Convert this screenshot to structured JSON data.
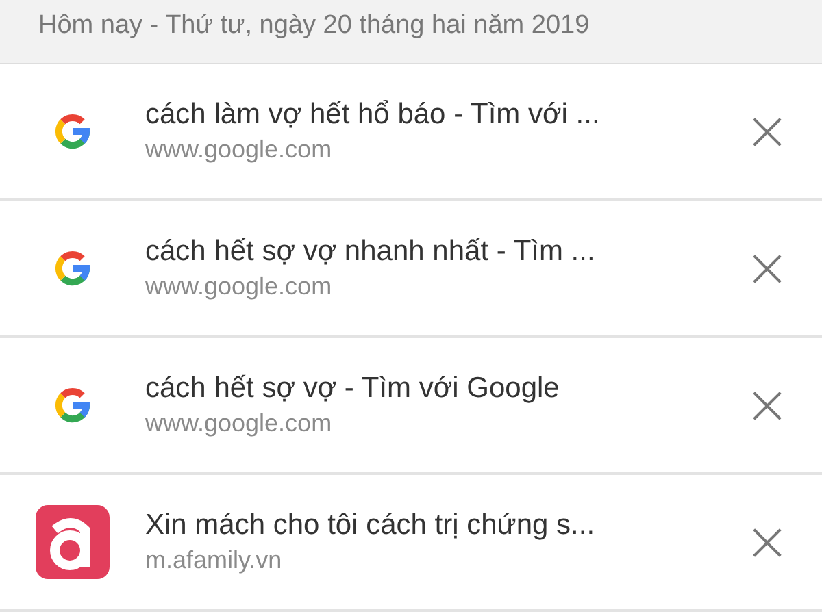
{
  "header": {
    "date": "Hôm nay - Thứ tư, ngày 20 tháng hai năm 2019"
  },
  "entries": [
    {
      "kind": "google",
      "title": "cách làm vợ hết hổ báo - Tìm với ...",
      "url": "www.google.com",
      "remove": "×"
    },
    {
      "kind": "google",
      "title": "cách hết sợ vợ nhanh nhất - Tìm ...",
      "url": "www.google.com",
      "remove": "×"
    },
    {
      "kind": "google",
      "title": "cách hết sợ vợ - Tìm với Google",
      "url": "www.google.com",
      "remove": "×"
    },
    {
      "kind": "afamily",
      "title": "Xin mách cho tôi cách trị chứng s...",
      "url": "m.afamily.vn",
      "remove": "×"
    }
  ]
}
